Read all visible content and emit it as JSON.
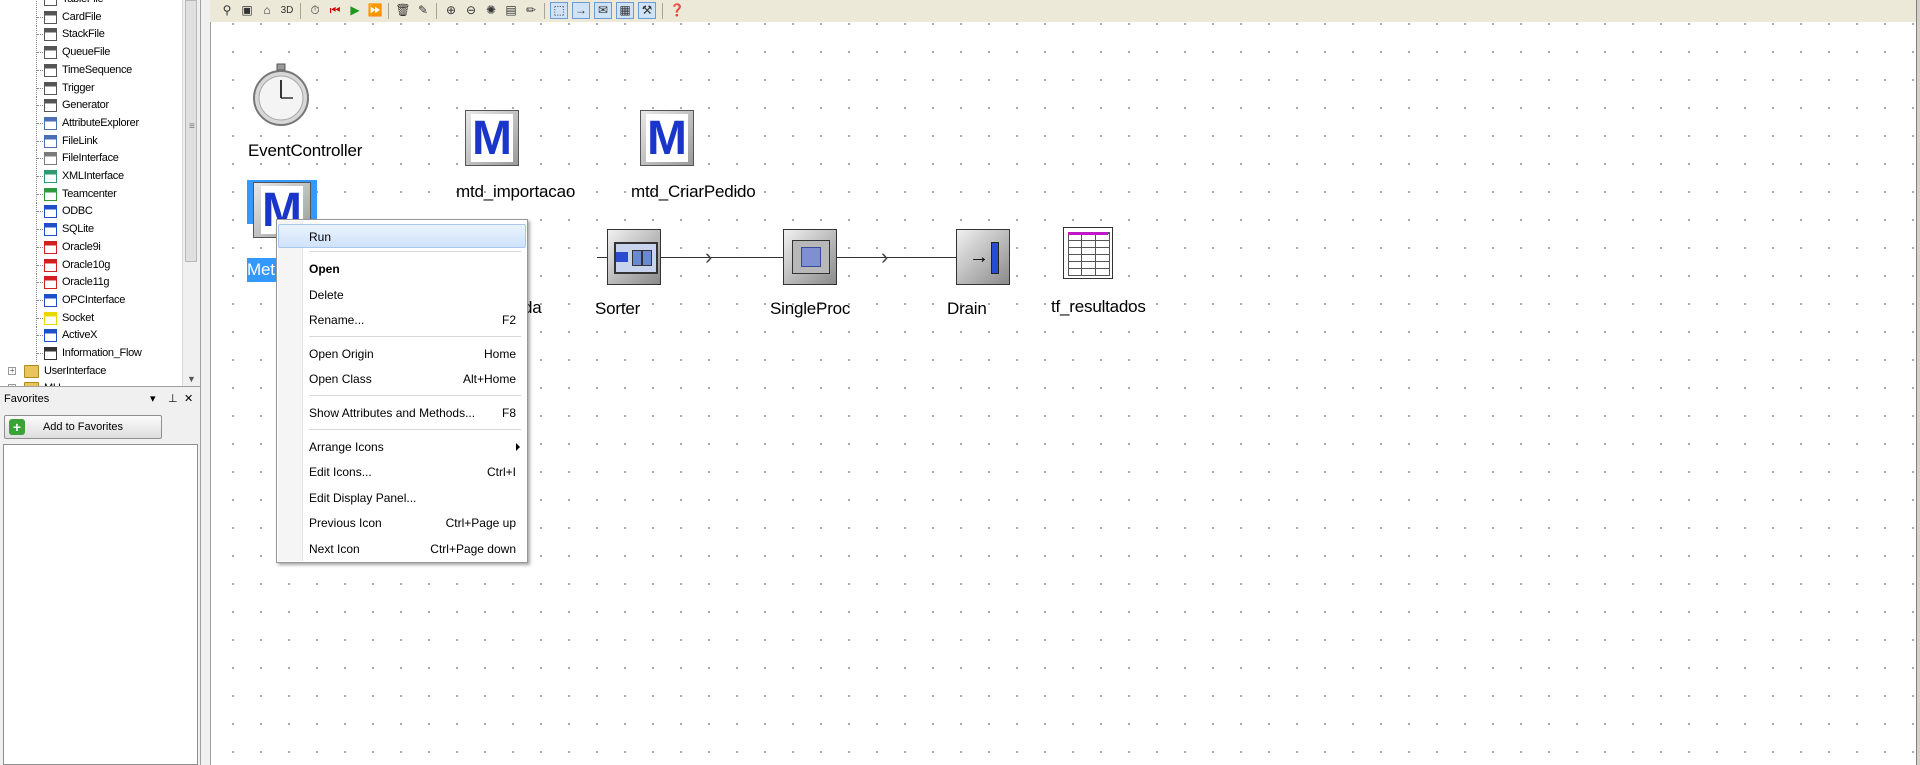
{
  "tree": {
    "items": [
      {
        "label": "TableFile",
        "icon": "tablefile-icon",
        "color": "#555555"
      },
      {
        "label": "CardFile",
        "icon": "cardfile-icon",
        "color": "#555555"
      },
      {
        "label": "StackFile",
        "icon": "stackfile-icon",
        "color": "#555555"
      },
      {
        "label": "QueueFile",
        "icon": "queuefile-icon",
        "color": "#555555"
      },
      {
        "label": "TimeSequence",
        "icon": "timesequence-icon",
        "color": "#555555"
      },
      {
        "label": "Trigger",
        "icon": "trigger-icon",
        "color": "#555555"
      },
      {
        "label": "Generator",
        "icon": "generator-icon",
        "color": "#555555"
      },
      {
        "label": "AttributeExplorer",
        "icon": "attributeexplorer-icon",
        "color": "#4a6fb5"
      },
      {
        "label": "FileLink",
        "icon": "filelink-icon",
        "color": "#4a6fb5"
      },
      {
        "label": "FileInterface",
        "icon": "fileinterface-icon",
        "color": "#7a7a7a"
      },
      {
        "label": "XMLInterface",
        "icon": "xmlinterface-icon",
        "color": "#2e9a70"
      },
      {
        "label": "Teamcenter",
        "icon": "teamcenter-icon",
        "color": "#2e9a40"
      },
      {
        "label": "ODBC",
        "icon": "odbc-icon",
        "color": "#1e4fc8"
      },
      {
        "label": "SQLite",
        "icon": "sqlite-icon",
        "color": "#1e4fc8"
      },
      {
        "label": "Oracle9i",
        "icon": "oracle9i-icon",
        "color": "#d02020"
      },
      {
        "label": "Oracle10g",
        "icon": "oracle10g-icon",
        "color": "#d02020"
      },
      {
        "label": "Oracle11g",
        "icon": "oracle11g-icon",
        "color": "#d02020"
      },
      {
        "label": "OPCInterface",
        "icon": "opcinterface-icon",
        "color": "#1e4fc8"
      },
      {
        "label": "Socket",
        "icon": "socket-icon",
        "color": "#e8d800"
      },
      {
        "label": "ActiveX",
        "icon": "activex-icon",
        "color": "#1e4fc8"
      },
      {
        "label": "Information_Flow",
        "icon": "information-flow-icon",
        "color": "#333333"
      },
      {
        "label": "UserInterface",
        "icon": "folder-icon",
        "color": "#e8c55a"
      },
      {
        "label": "MU",
        "icon": "folder-icon",
        "color": "#e8c55a"
      }
    ]
  },
  "favorites": {
    "title": "Favorites",
    "add_button": "Add to Favorites",
    "dropdown_glyph": "▾",
    "pin_glyph": "⊥",
    "close_glyph": "✕"
  },
  "canvas": {
    "objects": {
      "event_controller": "EventController",
      "mtd_importacao": "mtd_importacao",
      "mtd_criar_pedido": "mtd_CriarPedido",
      "method_selected": "Met",
      "entrada_partial": "da",
      "sorter": "Sorter",
      "single_proc": "SingleProc",
      "drain": "Drain",
      "tf_resultados": "tf_resultados"
    }
  },
  "context_menu": {
    "run": "Run",
    "open": "Open",
    "delete": "Delete",
    "rename": "Rename...",
    "rename_sc": "F2",
    "open_origin": "Open Origin",
    "open_origin_sc": "Home",
    "open_class": "Open Class",
    "open_class_sc": "Alt+Home",
    "show_attr": "Show Attributes and Methods...",
    "show_attr_sc": "F8",
    "arrange_icons": "Arrange Icons",
    "edit_icons": "Edit Icons...",
    "edit_icons_sc": "Ctrl+I",
    "edit_display": "Edit Display Panel...",
    "prev_icon": "Previous Icon",
    "prev_icon_sc": "Ctrl+Page up",
    "next_icon": "Next Icon",
    "next_icon_sc": "Ctrl+Page down"
  },
  "colors": {
    "method_blue": "#1a35c9",
    "selection_blue": "#3399ff",
    "menu_highlight": "#cfe3fb"
  }
}
